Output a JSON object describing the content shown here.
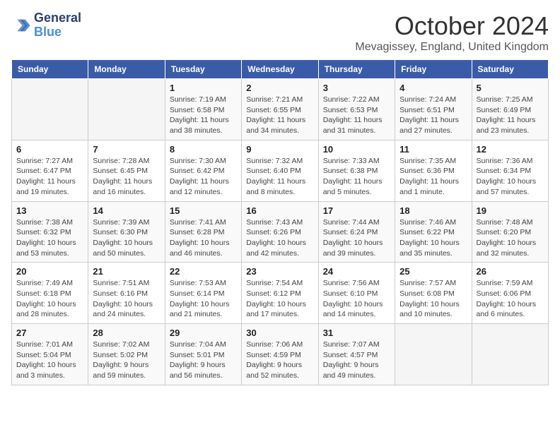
{
  "header": {
    "logo_line1": "General",
    "logo_line2": "Blue",
    "month": "October 2024",
    "location": "Mevagissey, England, United Kingdom"
  },
  "days_of_week": [
    "Sunday",
    "Monday",
    "Tuesday",
    "Wednesday",
    "Thursday",
    "Friday",
    "Saturday"
  ],
  "weeks": [
    [
      {
        "day": "",
        "detail": ""
      },
      {
        "day": "",
        "detail": ""
      },
      {
        "day": "1",
        "detail": "Sunrise: 7:19 AM\nSunset: 6:58 PM\nDaylight: 11 hours and 38 minutes."
      },
      {
        "day": "2",
        "detail": "Sunrise: 7:21 AM\nSunset: 6:55 PM\nDaylight: 11 hours and 34 minutes."
      },
      {
        "day": "3",
        "detail": "Sunrise: 7:22 AM\nSunset: 6:53 PM\nDaylight: 11 hours and 31 minutes."
      },
      {
        "day": "4",
        "detail": "Sunrise: 7:24 AM\nSunset: 6:51 PM\nDaylight: 11 hours and 27 minutes."
      },
      {
        "day": "5",
        "detail": "Sunrise: 7:25 AM\nSunset: 6:49 PM\nDaylight: 11 hours and 23 minutes."
      }
    ],
    [
      {
        "day": "6",
        "detail": "Sunrise: 7:27 AM\nSunset: 6:47 PM\nDaylight: 11 hours and 19 minutes."
      },
      {
        "day": "7",
        "detail": "Sunrise: 7:28 AM\nSunset: 6:45 PM\nDaylight: 11 hours and 16 minutes."
      },
      {
        "day": "8",
        "detail": "Sunrise: 7:30 AM\nSunset: 6:42 PM\nDaylight: 11 hours and 12 minutes."
      },
      {
        "day": "9",
        "detail": "Sunrise: 7:32 AM\nSunset: 6:40 PM\nDaylight: 11 hours and 8 minutes."
      },
      {
        "day": "10",
        "detail": "Sunrise: 7:33 AM\nSunset: 6:38 PM\nDaylight: 11 hours and 5 minutes."
      },
      {
        "day": "11",
        "detail": "Sunrise: 7:35 AM\nSunset: 6:36 PM\nDaylight: 11 hours and 1 minute."
      },
      {
        "day": "12",
        "detail": "Sunrise: 7:36 AM\nSunset: 6:34 PM\nDaylight: 10 hours and 57 minutes."
      }
    ],
    [
      {
        "day": "13",
        "detail": "Sunrise: 7:38 AM\nSunset: 6:32 PM\nDaylight: 10 hours and 53 minutes."
      },
      {
        "day": "14",
        "detail": "Sunrise: 7:39 AM\nSunset: 6:30 PM\nDaylight: 10 hours and 50 minutes."
      },
      {
        "day": "15",
        "detail": "Sunrise: 7:41 AM\nSunset: 6:28 PM\nDaylight: 10 hours and 46 minutes."
      },
      {
        "day": "16",
        "detail": "Sunrise: 7:43 AM\nSunset: 6:26 PM\nDaylight: 10 hours and 42 minutes."
      },
      {
        "day": "17",
        "detail": "Sunrise: 7:44 AM\nSunset: 6:24 PM\nDaylight: 10 hours and 39 minutes."
      },
      {
        "day": "18",
        "detail": "Sunrise: 7:46 AM\nSunset: 6:22 PM\nDaylight: 10 hours and 35 minutes."
      },
      {
        "day": "19",
        "detail": "Sunrise: 7:48 AM\nSunset: 6:20 PM\nDaylight: 10 hours and 32 minutes."
      }
    ],
    [
      {
        "day": "20",
        "detail": "Sunrise: 7:49 AM\nSunset: 6:18 PM\nDaylight: 10 hours and 28 minutes."
      },
      {
        "day": "21",
        "detail": "Sunrise: 7:51 AM\nSunset: 6:16 PM\nDaylight: 10 hours and 24 minutes."
      },
      {
        "day": "22",
        "detail": "Sunrise: 7:53 AM\nSunset: 6:14 PM\nDaylight: 10 hours and 21 minutes."
      },
      {
        "day": "23",
        "detail": "Sunrise: 7:54 AM\nSunset: 6:12 PM\nDaylight: 10 hours and 17 minutes."
      },
      {
        "day": "24",
        "detail": "Sunrise: 7:56 AM\nSunset: 6:10 PM\nDaylight: 10 hours and 14 minutes."
      },
      {
        "day": "25",
        "detail": "Sunrise: 7:57 AM\nSunset: 6:08 PM\nDaylight: 10 hours and 10 minutes."
      },
      {
        "day": "26",
        "detail": "Sunrise: 7:59 AM\nSunset: 6:06 PM\nDaylight: 10 hours and 6 minutes."
      }
    ],
    [
      {
        "day": "27",
        "detail": "Sunrise: 7:01 AM\nSunset: 5:04 PM\nDaylight: 10 hours and 3 minutes."
      },
      {
        "day": "28",
        "detail": "Sunrise: 7:02 AM\nSunset: 5:02 PM\nDaylight: 9 hours and 59 minutes."
      },
      {
        "day": "29",
        "detail": "Sunrise: 7:04 AM\nSunset: 5:01 PM\nDaylight: 9 hours and 56 minutes."
      },
      {
        "day": "30",
        "detail": "Sunrise: 7:06 AM\nSunset: 4:59 PM\nDaylight: 9 hours and 52 minutes."
      },
      {
        "day": "31",
        "detail": "Sunrise: 7:07 AM\nSunset: 4:57 PM\nDaylight: 9 hours and 49 minutes."
      },
      {
        "day": "",
        "detail": ""
      },
      {
        "day": "",
        "detail": ""
      }
    ]
  ]
}
